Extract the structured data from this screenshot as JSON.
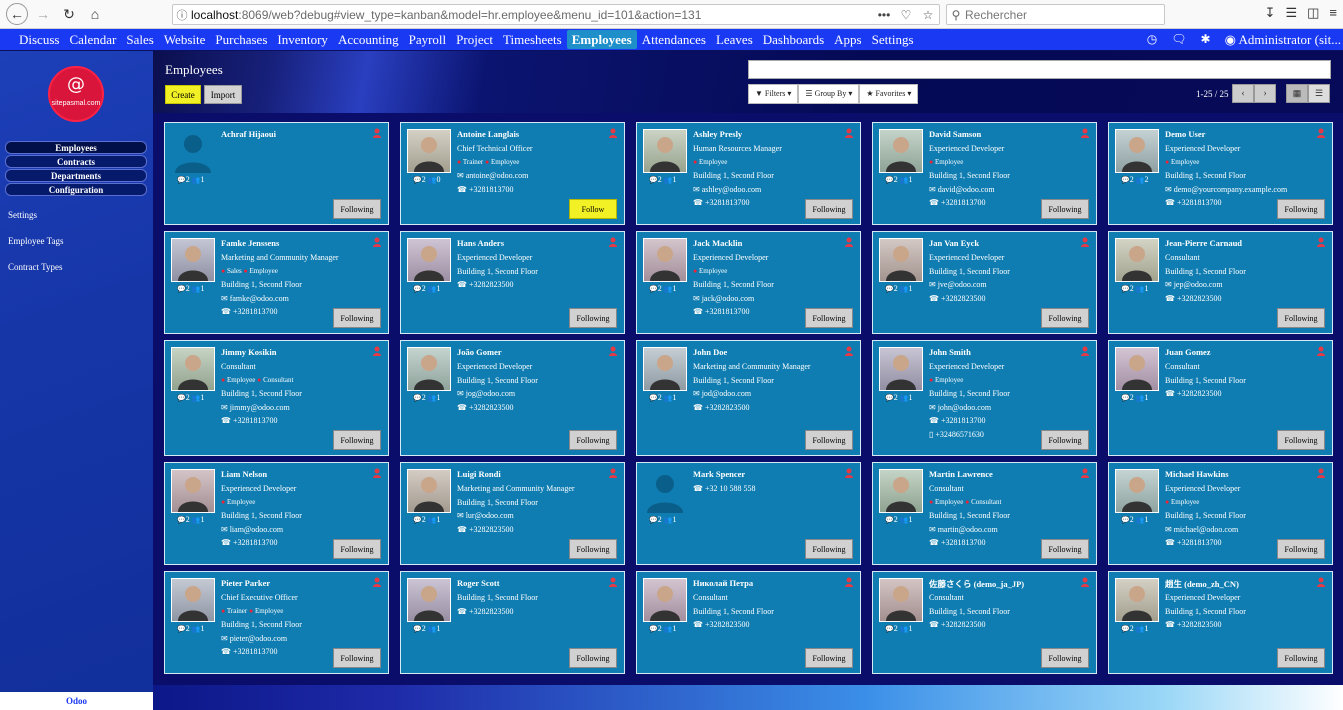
{
  "browser": {
    "url_host": "localhost",
    "url_path": ":8069/web?debug#view_type=kanban&model=hr.employee&menu_id=101&action=131",
    "search_placeholder": "Rechercher",
    "url_more": "•••"
  },
  "topmenu": {
    "items": [
      "Discuss",
      "Calendar",
      "Sales",
      "Website",
      "Purchases",
      "Inventory",
      "Accounting",
      "Payroll",
      "Project",
      "Timesheets",
      "Employees",
      "Attendances",
      "Leaves",
      "Dashboards",
      "Apps",
      "Settings"
    ],
    "active": "Employees",
    "user": "Administrator (sit..."
  },
  "sidebar": {
    "logo_text": "sitepasmal.com",
    "logo_symbol": "@",
    "menu": [
      "Employees",
      "Contracts",
      "Departments",
      "Configuration"
    ],
    "links": [
      "Settings",
      "Employee Tags",
      "Contract Types"
    ],
    "footer": "Odoo"
  },
  "header": {
    "breadcrumb": "Employees",
    "create_label": "Create",
    "import_label": "Import",
    "filters_label": "Filters",
    "groupby_label": "Group By",
    "favorites_label": "Favorites",
    "pager": "1-25 / 25"
  },
  "cards": [
    {
      "name": "Achraf Hijaoui",
      "lines": [],
      "stats": "2  1",
      "follow": "Following",
      "following": true,
      "placeholder": true
    },
    {
      "name": "Antoine Langlais",
      "lines": [
        "Chief Technical Officer",
        "TAGS:Trainer|Employee",
        "antoine@odoo.com",
        "+3281813700"
      ],
      "stats": "2  0",
      "follow": "Follow",
      "following": false
    },
    {
      "name": "Ashley Presly",
      "lines": [
        "Human Resources Manager",
        "TAGS:Employee",
        "Building 1, Second Floor",
        "ashley@odoo.com",
        "+3281813700"
      ],
      "stats": "2  1",
      "follow": "Following",
      "following": true
    },
    {
      "name": "David Samson",
      "lines": [
        "Experienced Developer",
        "TAGS:Employee",
        "Building 1, Second Floor",
        "david@odoo.com",
        "+3281813700"
      ],
      "stats": "2  1",
      "follow": "Following",
      "following": true
    },
    {
      "name": "Demo User",
      "lines": [
        "Experienced Developer",
        "TAGS:Employee",
        "Building 1, Second Floor",
        "demo@yourcompany.example.com",
        "+3281813700"
      ],
      "stats": "2  2",
      "follow": "Following",
      "following": true
    },
    {
      "name": "Famke Jenssens",
      "lines": [
        "Marketing and Community Manager",
        "TAGS:Sales|Employee",
        "Building 1, Second Floor",
        "famke@odoo.com",
        "+3281813700"
      ],
      "stats": "2  1",
      "follow": "Following",
      "following": true
    },
    {
      "name": "Hans Anders",
      "lines": [
        "Experienced Developer",
        "Building 1, Second Floor",
        "+3282823500"
      ],
      "stats": "2  1",
      "follow": "Following",
      "following": true
    },
    {
      "name": "Jack Macklin",
      "lines": [
        "Experienced Developer",
        "TAGS:Employee",
        "Building 1, Second Floor",
        "jack@odoo.com",
        "+3281813700"
      ],
      "stats": "2  1",
      "follow": "Following",
      "following": true
    },
    {
      "name": "Jan Van Eyck",
      "lines": [
        "Experienced Developer",
        "Building 1, Second Floor",
        "jve@odoo.com",
        "+3282823500"
      ],
      "stats": "2  1",
      "follow": "Following",
      "following": true
    },
    {
      "name": "Jean-Pierre Carnaud",
      "lines": [
        "Consultant",
        "Building 1, Second Floor",
        "jep@odoo.com",
        "+3282823500"
      ],
      "stats": "2  1",
      "follow": "Following",
      "following": true
    },
    {
      "name": "Jimmy Kosikin",
      "lines": [
        "Consultant",
        "TAGS:Employee|Consultant",
        "Building 1, Second Floor",
        "jimmy@odoo.com",
        "+3281813700"
      ],
      "stats": "2  1",
      "follow": "Following",
      "following": true
    },
    {
      "name": "João Gomer",
      "lines": [
        "Experienced Developer",
        "Building 1, Second Floor",
        "jog@odoo.com",
        "+3282823500"
      ],
      "stats": "2  1",
      "follow": "Following",
      "following": true
    },
    {
      "name": "John Doe",
      "lines": [
        "Marketing and Community Manager",
        "Building 1, Second Floor",
        "jod@odoo.com",
        "+3282823500"
      ],
      "stats": "2  1",
      "follow": "Following",
      "following": true
    },
    {
      "name": "John Smith",
      "lines": [
        "Experienced Developer",
        "TAGS:Employee",
        "Building 1, Second Floor",
        "john@odoo.com",
        "+3281813700",
        "+32486571630"
      ],
      "stats": "2  1",
      "follow": "Following",
      "following": true
    },
    {
      "name": "Juan Gomez",
      "lines": [
        "Consultant",
        "Building 1, Second Floor",
        "+3282823500"
      ],
      "stats": "2  1",
      "follow": "Following",
      "following": true
    },
    {
      "name": "Liam Nelson",
      "lines": [
        "Experienced Developer",
        "TAGS:Employee",
        "Building 1, Second Floor",
        "liam@odoo.com",
        "+3281813700"
      ],
      "stats": "2  1",
      "follow": "Following",
      "following": true
    },
    {
      "name": "Luigi Rondi",
      "lines": [
        "Marketing and Community Manager",
        "Building 1, Second Floor",
        "lur@odoo.com",
        "+3282823500"
      ],
      "stats": "2  1",
      "follow": "Following",
      "following": true
    },
    {
      "name": "Mark Spencer",
      "lines": [
        "+32 10 588 558"
      ],
      "stats": "2  1",
      "follow": "Following",
      "following": true,
      "placeholder": true
    },
    {
      "name": "Martin Lawrence",
      "lines": [
        "Consultant",
        "TAGS:Employee|Consultant",
        "Building 1, Second Floor",
        "martin@odoo.com",
        "+3281813700"
      ],
      "stats": "2  1",
      "follow": "Following",
      "following": true
    },
    {
      "name": "Michael Hawkins",
      "lines": [
        "Experienced Developer",
        "TAGS:Employee",
        "Building 1, Second Floor",
        "michael@odoo.com",
        "+3281813700"
      ],
      "stats": "2  1",
      "follow": "Following",
      "following": true
    },
    {
      "name": "Pieter Parker",
      "lines": [
        "Chief Executive Officer",
        "TAGS:Trainer|Employee",
        "Building 1, Second Floor",
        "pieter@odoo.com",
        "+3281813700"
      ],
      "stats": "2  1",
      "follow": "Following",
      "following": true
    },
    {
      "name": "Roger Scott",
      "lines": [
        "Building 1, Second Floor",
        "+3282823500"
      ],
      "stats": "2  1",
      "follow": "Following",
      "following": true
    },
    {
      "name": "Николай Петра",
      "lines": [
        "Consultant",
        "Building 1, Second Floor",
        "+3282823500"
      ],
      "stats": "2  1",
      "follow": "Following",
      "following": true
    },
    {
      "name": "佐藤さくら (demo_ja_JP)",
      "lines": [
        "Consultant",
        "Building 1, Second Floor",
        "+3282823500"
      ],
      "stats": "2  1",
      "follow": "Following",
      "following": true
    },
    {
      "name": "趙生 (demo_zh_CN)",
      "lines": [
        "Experienced Developer",
        "Building 1, Second Floor",
        "+3282823500"
      ],
      "stats": "2  1",
      "follow": "Following",
      "following": true
    }
  ],
  "colors": {
    "menu": "#1a39f2",
    "card": "#0f7db1",
    "follow": "#f1f126",
    "tag": "#ee2233"
  }
}
